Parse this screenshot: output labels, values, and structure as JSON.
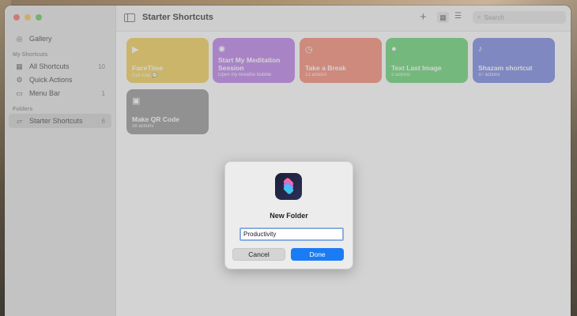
{
  "sidebar": {
    "gallery_label": "Gallery",
    "my_shortcuts_header": "My Shortcuts",
    "items": [
      {
        "label": "All Shortcuts",
        "count": "10"
      },
      {
        "label": "Quick Actions",
        "count": ""
      },
      {
        "label": "Menu Bar",
        "count": "1"
      }
    ],
    "folders_header": "Folders",
    "folders": [
      {
        "label": "Starter Shortcuts",
        "count": "6"
      }
    ]
  },
  "toolbar": {
    "title": "Starter Shortcuts",
    "search_placeholder": "Search"
  },
  "cards": [
    {
      "title": "FaceTime",
      "subtitle": "Call Ariel 💬",
      "icon": "video-icon",
      "color": "#f2cc4a"
    },
    {
      "title": "Start My Meditation Session",
      "subtitle": "Open my Breathe Bubble",
      "icon": "sparkle-icon",
      "color": "#b578e8"
    },
    {
      "title": "Take a Break",
      "subtitle": "13 actions",
      "icon": "clock-icon",
      "color": "#f5826b"
    },
    {
      "title": "Text Last Image",
      "subtitle": "3 actions",
      "icon": "message-icon",
      "color": "#5ed06b"
    },
    {
      "title": "Shazam shortcut",
      "subtitle": "37 actions",
      "icon": "mic-icon",
      "color": "#6f7fe0"
    },
    {
      "title": "Make QR Code",
      "subtitle": "38 actions",
      "icon": "qr-icon",
      "color": "#8e8e8e"
    }
  ],
  "dialog": {
    "title": "New Folder",
    "input_value": "Productivity",
    "cancel_label": "Cancel",
    "done_label": "Done"
  }
}
